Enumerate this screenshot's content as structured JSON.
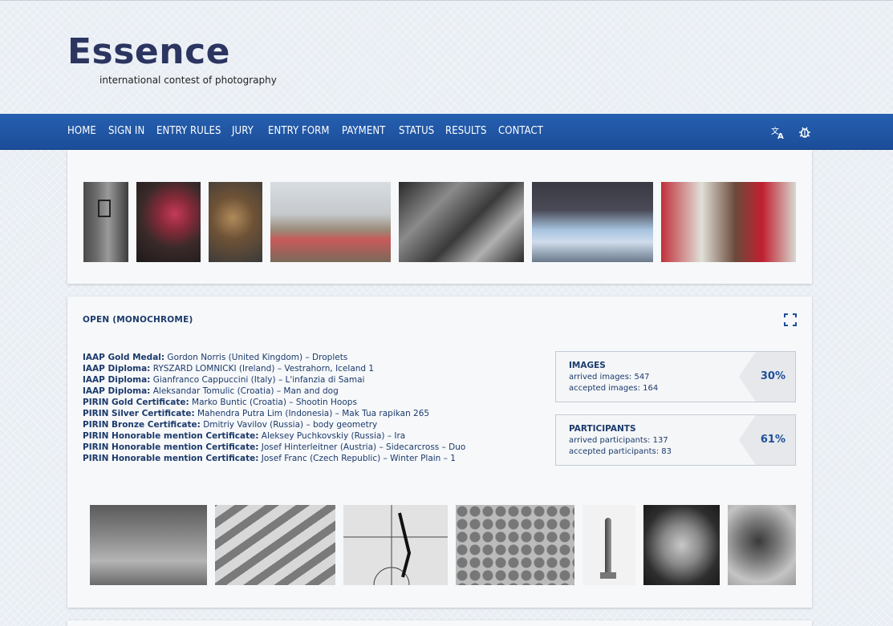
{
  "brand": {
    "title": "Essence",
    "subtitle": "international contest of photography"
  },
  "nav": {
    "items": [
      {
        "label": "HOME"
      },
      {
        "label": "SIGN IN"
      },
      {
        "label": "ENTRY RULES"
      },
      {
        "label": "JURY"
      },
      {
        "label": "ENTRY FORM"
      },
      {
        "label": "PAYMENT"
      },
      {
        "label": "STATUS"
      },
      {
        "label": "RESULTS"
      },
      {
        "label": "CONTACT"
      }
    ],
    "icons": [
      "translate-icon",
      "bug-icon"
    ]
  },
  "gallery_top": {
    "images": [
      {
        "icon": "photo-doorway-monochrome"
      },
      {
        "icon": "photo-dancers"
      },
      {
        "icon": "photo-drummer-portrait"
      },
      {
        "icon": "photo-village-crowd"
      },
      {
        "icon": "photo-orchestra-monochrome"
      },
      {
        "icon": "photo-ballet"
      },
      {
        "icon": "photo-parade-drummer"
      }
    ]
  },
  "section": {
    "title": "OPEN (MONOCHROME)",
    "expand_icon": "expand-icon",
    "awards": [
      {
        "award": "IAAP Gold Medal:",
        "entry": " Gordon Norris (United Kingdom) – Droplets"
      },
      {
        "award": "IAAP Diploma:",
        "entry": " RYSZARD LOMNICKI (Ireland) – Vestrahorn, Iceland 1"
      },
      {
        "award": "IAAP Diploma:",
        "entry": " Gianfranco Cappuccini (Italy) – L'infanzia di Samai"
      },
      {
        "award": "IAAP Diploma:",
        "entry": " Aleksandar Tomulic (Croatia) – Man and dog"
      },
      {
        "award": "PIRIN Gold Certificate:",
        "entry": " Marko Buntic (Croatia) – Shootin Hoops"
      },
      {
        "award": "PIRIN Silver Certificate:",
        "entry": " Mahendra Putra Lim (Indonesia) – Mak Tua rapikan 265"
      },
      {
        "award": "PIRIN Bronze Certificate:",
        "entry": " Dmitriy Vavilov (Russia) – body geometry"
      },
      {
        "award": "PIRIN Honorable mention Certificate:",
        "entry": " Aleksey Puchkovskiy (Russia) – Ira"
      },
      {
        "award": "PIRIN Honorable mention Certificate:",
        "entry": " Josef Hinterleitner (Austria) – Sidecarcross – Duo"
      },
      {
        "award": "PIRIN Honorable mention Certificate:",
        "entry": " Josef Franc (Czech Republic) – Winter Plain – 1"
      }
    ],
    "stats": [
      {
        "title": "IMAGES",
        "line1": "arrived images: 547",
        "line2": "accepted images: 164",
        "percent": "30%",
        "value": 0.3
      },
      {
        "title": "PARTICIPANTS",
        "line1": "arrived participants: 137",
        "line2": "accepted participants: 83",
        "percent": "61%",
        "value": 0.61
      }
    ],
    "gallery": [
      {
        "icon": "photo-three-girls"
      },
      {
        "icon": "photo-crosswalk"
      },
      {
        "icon": "photo-basketball-court"
      },
      {
        "icon": "photo-bowls-pattern"
      },
      {
        "icon": "photo-sculpture"
      },
      {
        "icon": "photo-mirrored-face"
      },
      {
        "icon": "photo-motocross"
      }
    ]
  },
  "colors": {
    "nav": "#1f56a5",
    "brand": "#2b3560",
    "text": "#1c3a6b",
    "accent": "#1e4f9a"
  }
}
